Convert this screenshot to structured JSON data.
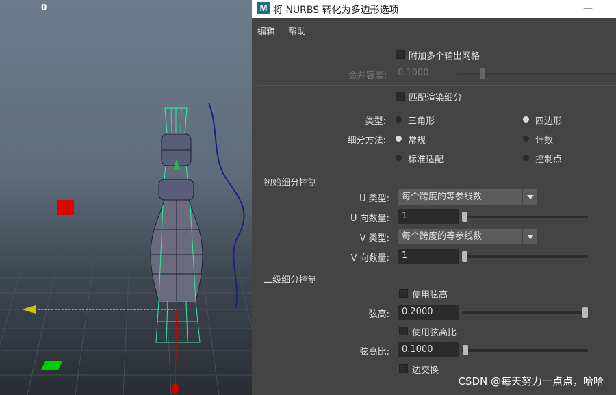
{
  "viewport": {
    "frame_counter": "0"
  },
  "dialog": {
    "app_icon": "M",
    "title": "将 NURBS 转化为多边形选项",
    "minimize": "—"
  },
  "menu": {
    "edit": "编辑",
    "help": "帮助"
  },
  "options": {
    "attach_output_label": "附加多个输出网格",
    "merge_tolerance_label": "合并容差:",
    "merge_tolerance_value": "0.1000",
    "match_render_label": "匹配渲染细分",
    "type_label": "类型:",
    "type_triangles": "三角形",
    "type_quads": "四边形",
    "tessellation_label": "细分方法:",
    "tess_standard": "常规",
    "tess_count": "计数",
    "tess_general_fit": "标准适配",
    "tess_control_points": "控制点"
  },
  "initial_tessellation": {
    "title": "初始细分控制",
    "u_type_label": "U 类型:",
    "u_type_value": "每个跨度的等参线数",
    "u_number_label": "U 向数量:",
    "u_number_value": "1",
    "v_type_label": "V 类型:",
    "v_type_value": "每个跨度的等参线数",
    "v_number_label": "V 向数量:",
    "v_number_value": "1"
  },
  "secondary_tessellation": {
    "title": "二级细分控制",
    "use_chord_height_label": "使用弦高",
    "chord_height_label": "弦高:",
    "chord_height_value": "0.2000",
    "use_chord_ratio_label": "使用弦高比",
    "chord_ratio_label": "弦高比:",
    "chord_ratio_value": "0.1000",
    "edge_swap_label": "边交换"
  },
  "watermark": "CSDN @每天努力一点点，哈哈"
}
